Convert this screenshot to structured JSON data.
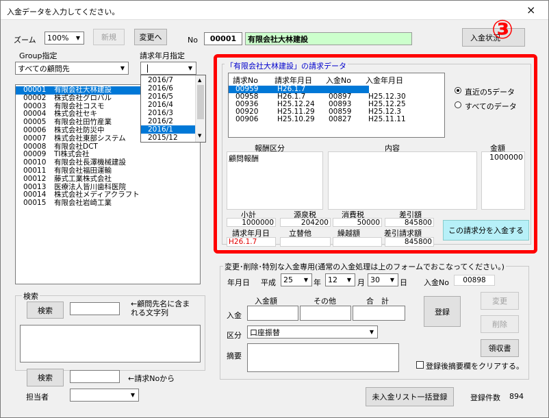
{
  "window": {
    "title": "入金データを入力してください。",
    "close_icon": "×"
  },
  "toolbar": {
    "zoom_label": "ズーム",
    "zoom_value": "100%",
    "new_button": "新規",
    "change_button": "変更へ",
    "no_label": "No",
    "no_value": "00001",
    "company_name": "有限会社大林建設",
    "payment_status_button": "入金状況",
    "badge": "③"
  },
  "filters": {
    "group_label": "Group指定",
    "group_value": "すべての顧問先",
    "billing_month_label": "請求年月指定",
    "billing_month_value": "",
    "month_options": [
      "2016/7",
      "2016/6",
      "2016/5",
      "2016/4",
      "2016/3",
      "2016/2",
      "2016/1",
      "2015/12"
    ],
    "selected_month": "2016/1"
  },
  "clients": [
    {
      "id": "00001",
      "name": "有限会社大林建設"
    },
    {
      "id": "00002",
      "name": "株式会社グロバル"
    },
    {
      "id": "00003",
      "name": "有限会社コスモ"
    },
    {
      "id": "00004",
      "name": "株式会社セキ"
    },
    {
      "id": "00005",
      "name": "有限会社田竹産業"
    },
    {
      "id": "00006",
      "name": "株式会社防災中"
    },
    {
      "id": "00007",
      "name": "株式会社東部システム"
    },
    {
      "id": "00008",
      "name": "有限会社DCT"
    },
    {
      "id": "00009",
      "name": "TI株式会社"
    },
    {
      "id": "00010",
      "name": "有限会社長澤機械建設"
    },
    {
      "id": "00011",
      "name": "有限会社福田運輸"
    },
    {
      "id": "00012",
      "name": "藤式工業株式会社"
    },
    {
      "id": "00013",
      "name": "医療法人皆川歯科医院"
    },
    {
      "id": "00014",
      "name": "株式会社メディアクラフト"
    },
    {
      "id": "00015",
      "name": "有限会社岩崎工業"
    }
  ],
  "search": {
    "group_title": "検索",
    "search_button": "検索",
    "hint1": "←顧問先名に含まれる文字列",
    "search_button2": "検索",
    "hint2": "←請求Noから",
    "staff_label": "担当者"
  },
  "billing": {
    "title": "「有限会社大林建設」の請求データ",
    "headers": [
      "請求No",
      "請求年月日",
      "入金No",
      "入金年月日"
    ],
    "rows": [
      [
        "00959",
        "H26.1.7",
        "",
        ""
      ],
      [
        "00958",
        "H26.1.7",
        "00897",
        "H25.12.30"
      ],
      [
        "00936",
        "H25.12.24",
        "00893",
        "H25.12.25"
      ],
      [
        "00920",
        "H25.11.29",
        "00859",
        "H25.12.3"
      ],
      [
        "00906",
        "H25.10.29",
        "00827",
        "H25.11.11"
      ]
    ],
    "radio_recent": "直近の5データ",
    "radio_all": "すべてのデータ",
    "remuneration_label": "報酬区分",
    "content_label": "内容",
    "amount_label": "金額",
    "remuneration_value": "顧問報酬",
    "amount_value": "1000000",
    "subtotal_label": "小計",
    "subtotal_value": "1000000",
    "withholding_label": "源泉税",
    "withholding_value": "204200",
    "consumption_label": "消費税",
    "consumption_value": "50000",
    "net_label": "差引額",
    "net_value": "845800",
    "billing_date_label": "請求年月日",
    "billing_date_value": "H26.1.7",
    "advance_label": "立替他",
    "advance_value": "",
    "carryover_label": "繰越額",
    "carryover_value": "",
    "net_billing_label": "差引請求額",
    "net_billing_value": "845800",
    "pay_button": "この請求分を入金する"
  },
  "special": {
    "title": "変更･削除･特別な入金専用(通常の入金処理は上のフォームでおこなってください。)",
    "date_label": "年月日",
    "era": "平成",
    "year": "25",
    "year_unit": "年",
    "month": "12",
    "month_unit": "月",
    "day": "30",
    "day_unit": "日",
    "payment_no_label": "入金No",
    "payment_no_value": "00898",
    "deposit_amount_label": "入金額",
    "other_label": "その他",
    "total_label": "合　計",
    "deposit_label": "入金",
    "category_label": "区分",
    "category_value": "口座振替",
    "memo_label": "摘要",
    "register_button": "登録",
    "change_button": "変更",
    "delete_button": "削除",
    "receipt_button": "領収書",
    "clear_checkbox_label": "登録後摘要欄をクリアする。"
  },
  "footer": {
    "bulk_register_button": "未入金リスト一括登録",
    "count_label": "登録件数",
    "count_value": "894"
  },
  "colors": {
    "highlight_red": "#ff0000",
    "selection_blue": "#0078d7",
    "company_green": "#ccffcc",
    "pay_button_cyan": "#b7f0f8"
  }
}
